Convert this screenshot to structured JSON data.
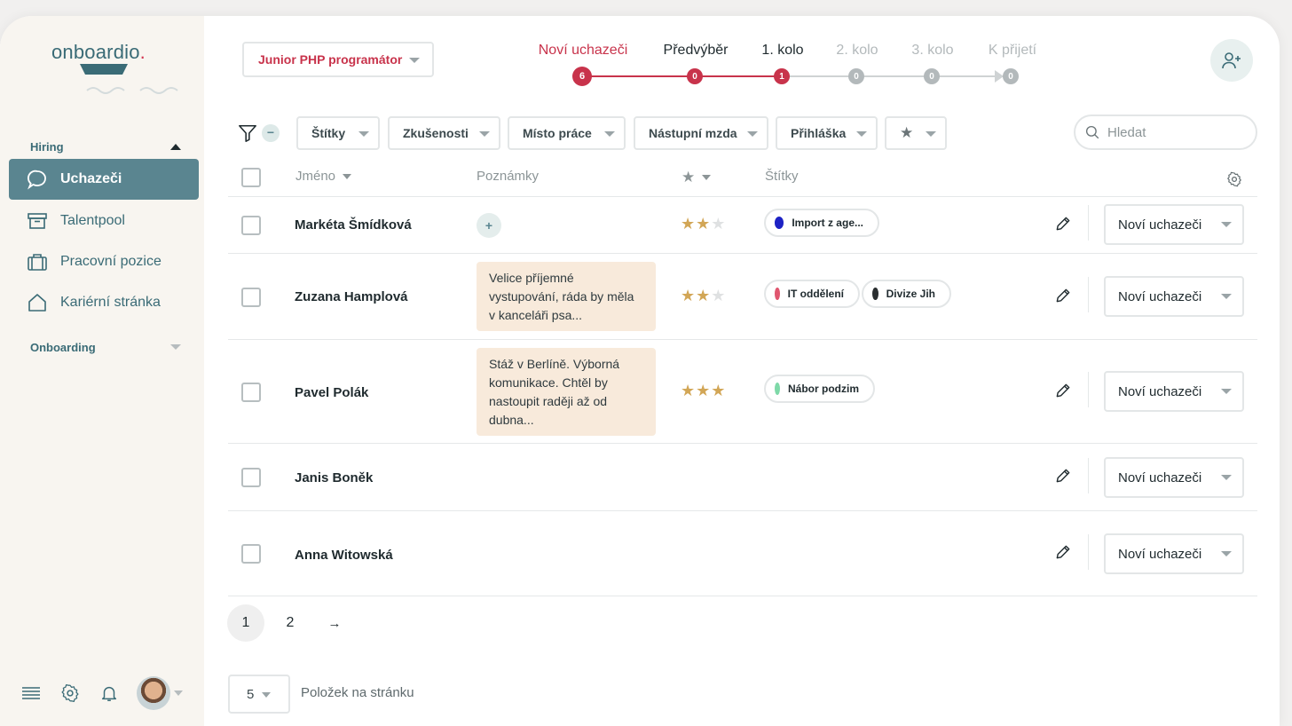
{
  "brand": {
    "name": "onboardio",
    "dot": ".",
    "accent": "#d33450",
    "primary": "#3a6b76"
  },
  "sidebar": {
    "section_hiring": "Hiring",
    "items": [
      {
        "label": "Uchazeči",
        "icon": "chat-bubble-icon",
        "active": true
      },
      {
        "label": "Talentpool",
        "icon": "archive-box-icon",
        "active": false
      },
      {
        "label": "Pracovní pozice",
        "icon": "briefcase-icon",
        "active": false
      },
      {
        "label": "Kariérní stránka",
        "icon": "home-icon",
        "active": false
      }
    ],
    "section_onboarding": "Onboarding",
    "bottom_icons": [
      "menu-icon",
      "gear-icon",
      "bell-icon",
      "avatar"
    ]
  },
  "job_select": {
    "value": "Junior PHP programátor"
  },
  "pipeline": {
    "stages": [
      {
        "label": "Noví uchazeči",
        "count": "6",
        "state": "current"
      },
      {
        "label": "Předvýběr",
        "count": "0",
        "state": "active"
      },
      {
        "label": "1. kolo",
        "count": "1",
        "state": "active"
      },
      {
        "label": "2. kolo",
        "count": "0",
        "state": "inactive"
      },
      {
        "label": "3. kolo",
        "count": "0",
        "state": "inactive"
      },
      {
        "label": "K přijetí",
        "count": "0",
        "state": "inactive"
      }
    ]
  },
  "filters": {
    "minus": "−",
    "chips": [
      "Štítky",
      "Zkušenosti",
      "Místo práce",
      "Nástupní mzda",
      "Přihláška",
      "★"
    ]
  },
  "search": {
    "placeholder": "Hledat"
  },
  "table": {
    "headers": {
      "name": "Jméno",
      "notes": "Poznámky",
      "stars": "★",
      "tags": "Štítky"
    },
    "rows": [
      {
        "name": "Markéta Šmídková",
        "note": "",
        "add_note": "+",
        "stars": 2,
        "tags": [
          {
            "label": "Import z age...",
            "color": "#1d22c4"
          }
        ],
        "status": "Noví uchazeči"
      },
      {
        "name": "Zuzana Hamplová",
        "note": "Velice příjemné vystupování, ráda by měla v kanceláři psa...",
        "stars": 2,
        "tags": [
          {
            "label": "IT oddělení",
            "color": "#e0566f"
          },
          {
            "label": "Divize Jih",
            "color": "#2a2e30"
          }
        ],
        "status": "Noví uchazeči"
      },
      {
        "name": "Pavel Polák",
        "note": "Stáž v Berlíně. Výborná komunikace. Chtěl by nastoupit raději až od dubna...",
        "stars": 3,
        "tags": [
          {
            "label": "Nábor podzim",
            "color": "#7ed9a8"
          }
        ],
        "status": "Noví uchazeči"
      },
      {
        "name": "Janis Boněk",
        "note": "",
        "stars": 0,
        "tags": [],
        "status": "Noví uchazeči"
      },
      {
        "name": "Anna Witowská",
        "note": "",
        "stars": 0,
        "tags": [],
        "status": "Noví uchazeči"
      }
    ]
  },
  "pagination": {
    "pages": [
      "1",
      "2"
    ],
    "current": "1",
    "next": "→"
  },
  "per_page": {
    "value": "5",
    "label": "Položek na stránku"
  }
}
